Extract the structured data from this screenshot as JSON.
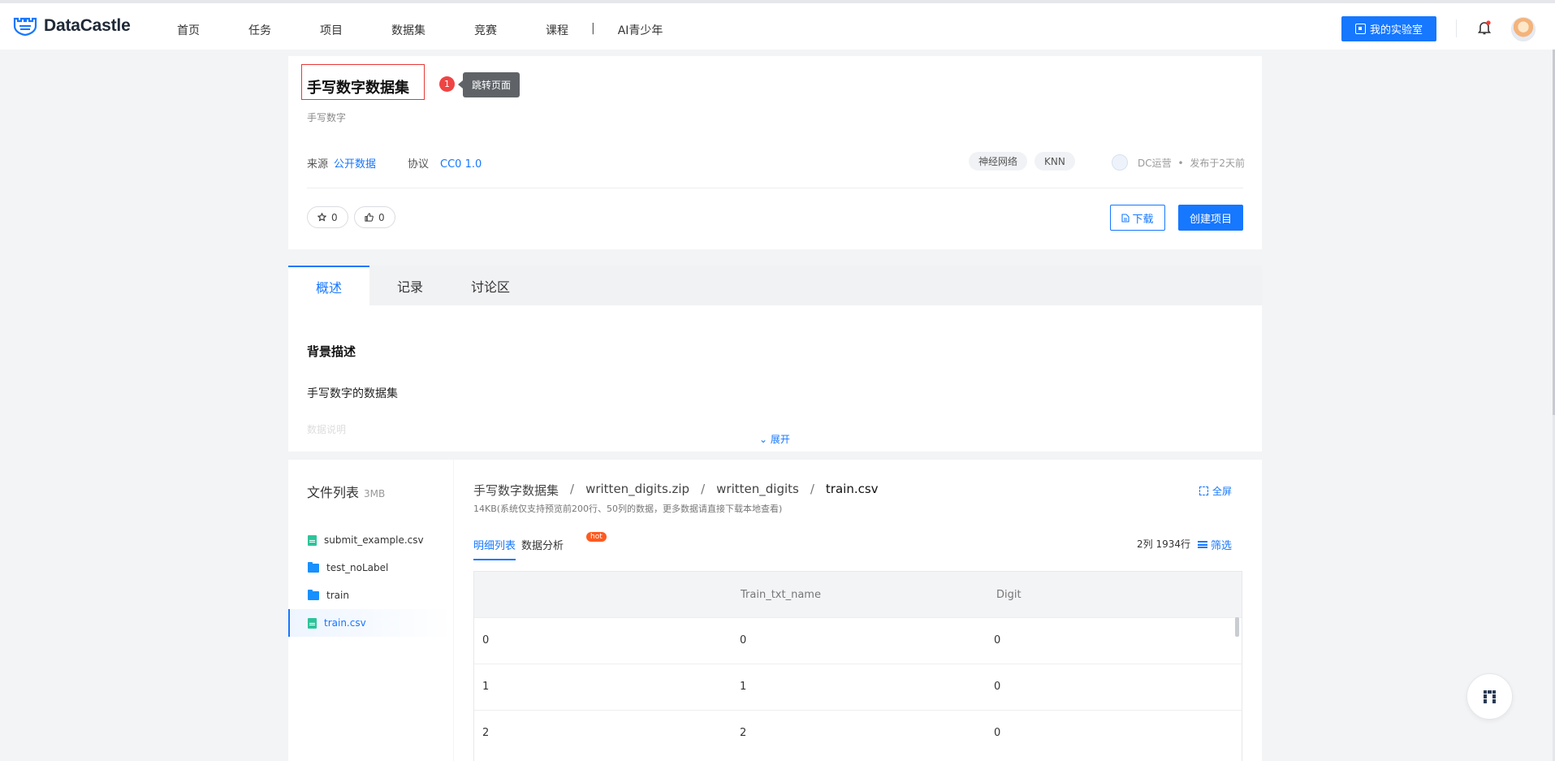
{
  "brand": {
    "name": "DataCastle",
    "color": "#1677ff"
  },
  "nav": {
    "items": [
      "首页",
      "任务",
      "项目",
      "数据集",
      "竞赛",
      "课程"
    ],
    "separator": "|",
    "extra": "AI青少年"
  },
  "top": {
    "lab_button": "我的实验室",
    "icons": [
      "bell-icon",
      "avatar"
    ]
  },
  "dataset": {
    "title": "手写数字数据集",
    "subtitle": "手写数字",
    "source_label": "来源",
    "source_value": "公开数据",
    "license_label": "协议",
    "license_value": "CC0 1.0",
    "tags": [
      "神经网络",
      "KNN"
    ],
    "author": "DC运营",
    "published": "发布于2天前",
    "author_sep": "•",
    "stars": "0",
    "likes": "0",
    "download_label": "下载",
    "create_label": "创建项目"
  },
  "annotation": {
    "number": "1",
    "tooltip": "跳转页面"
  },
  "tabs": [
    "概述",
    "记录",
    "讨论区"
  ],
  "overview": {
    "heading": "背景描述",
    "text": "手写数字的数据集",
    "faded": "数据说明",
    "expand": "展开"
  },
  "files": {
    "title": "文件列表",
    "size": "3MB",
    "items": [
      {
        "name": "submit_example.csv",
        "type": "file-icon"
      },
      {
        "name": "test_noLabel",
        "type": "folder-icon"
      },
      {
        "name": "train",
        "type": "folder-icon"
      },
      {
        "name": "train.csv",
        "type": "file-icon"
      }
    ]
  },
  "preview": {
    "breadcrumb": [
      "手写数字数据集",
      "written_digits.zip",
      "written_digits",
      "train.csv"
    ],
    "crumb_sep": "/",
    "fullscreen": "全屏",
    "note": "14KB(系统仅支持预览前200行、50列的数据，更多数据请直接下载本地查看)",
    "subtabs": [
      "明细列表",
      "数据分析"
    ],
    "hot": "hot",
    "rowcount": "2列 1934行",
    "filter": "筛选",
    "columns": [
      "",
      "Train_txt_name",
      "Digit"
    ],
    "rows": [
      [
        "0",
        "0",
        "0"
      ],
      [
        "1",
        "1",
        "0"
      ],
      [
        "2",
        "2",
        "0"
      ]
    ]
  }
}
